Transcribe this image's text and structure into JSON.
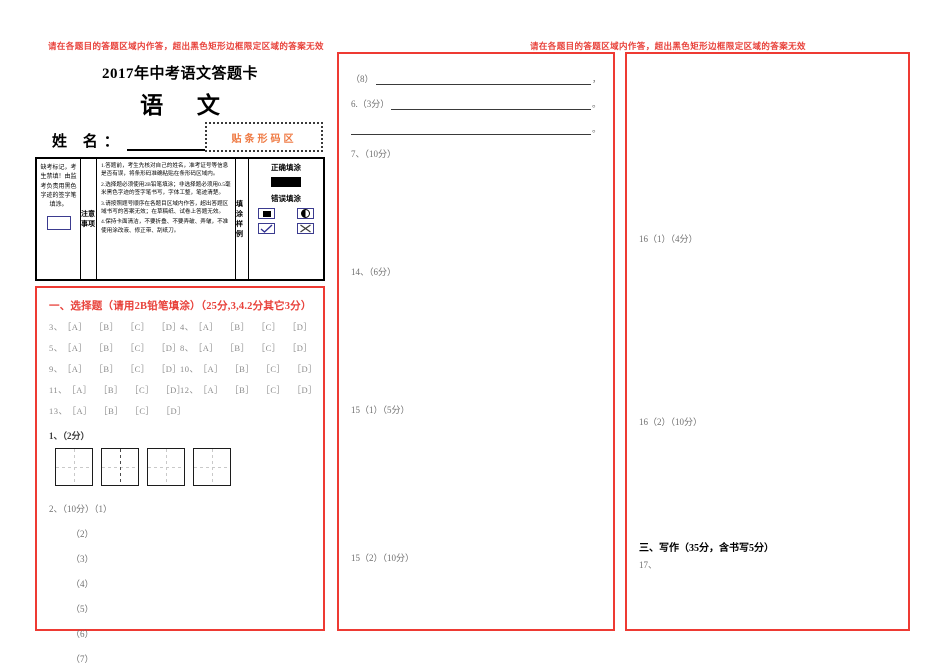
{
  "warnings": {
    "left": "请在各题目的答题区域内作答，超出黑色矩形边框限定区域的答案无效",
    "right": "请在各题目的答题区域内作答，超出黑色矩形边框限定区域的答案无效"
  },
  "header": {
    "title": "2017年中考语文答题卡",
    "subject": "语  文",
    "name_label": "姓  名：",
    "barcode_label": "贴条形码区"
  },
  "notes": {
    "absent_text": "缺考标记，考生禁填！由监考负责用黑色字迹的签字笔填涂。",
    "vertical_label_1": "注意事项",
    "vertical_label_2": "填涂样例",
    "items": [
      "1.答题前，考生先核对自己的姓名，准考证号等信息是否有误，将条形码准确粘贴在条形码区域内。",
      "2.选择题必须使用2B铅笔填涂；非选择题必须用0.5毫米黑色字迹的签字笔书写，字体工整，笔迹清楚。",
      "3.请按照题号顺序在各题目区域内作答，超出答题区域书写的答案无效；在草稿纸、试卷上答题无效。",
      "4.保持卡面清洁，不要折叠、不要弄破、弄皱，不准使用涂改液、修正带、刮纸刀。"
    ],
    "correct_title": "正确填涂",
    "wrong_title": "错误填涂"
  },
  "left_column": {
    "section_title": "一、选择题（请用2B铅笔填涂）（25分,3,4.2分其它3分）",
    "options": [
      "A",
      "B",
      "C",
      "D"
    ],
    "mc_rows": [
      [
        {
          "num": "3、"
        },
        {
          "num": "4、"
        }
      ],
      [
        {
          "num": "5、"
        },
        {
          "num": "8、"
        }
      ],
      [
        {
          "num": "9、"
        },
        {
          "num": "10、"
        }
      ],
      [
        {
          "num": "11、"
        },
        {
          "num": "12、"
        }
      ],
      [
        {
          "num": "13、"
        },
        {
          "num": ""
        }
      ]
    ],
    "q1_label": "1、（2分）",
    "grid_count": 4,
    "q2_label": "2、（10分）（1）",
    "q2_subitems": [
      "（2）",
      "（3）",
      "（4）",
      "（5）",
      "（6）",
      "（7）"
    ]
  },
  "mid_column": {
    "line_8_label": "（8）",
    "line_8_tail": "，",
    "q6_label": "6.（3分）",
    "q6_tail": "。",
    "q6_tail2": "。",
    "q7_label": "7、（10分）",
    "q14_label": "14、（6分）",
    "q15_1_label": "15（1）（5分）",
    "q15_2_label": "15（2）（10分）"
  },
  "right_column": {
    "q16_1_label": "16（1）（4分）",
    "q16_2_label": "16（2）（10分）",
    "writing_title": "三、写作（35分，含书写5分）",
    "q17_label": "17、"
  },
  "colors": {
    "accent_red": "#ee3a33",
    "barcode_orange": "#ef7b45",
    "gray_text": "#6f6f6f"
  }
}
